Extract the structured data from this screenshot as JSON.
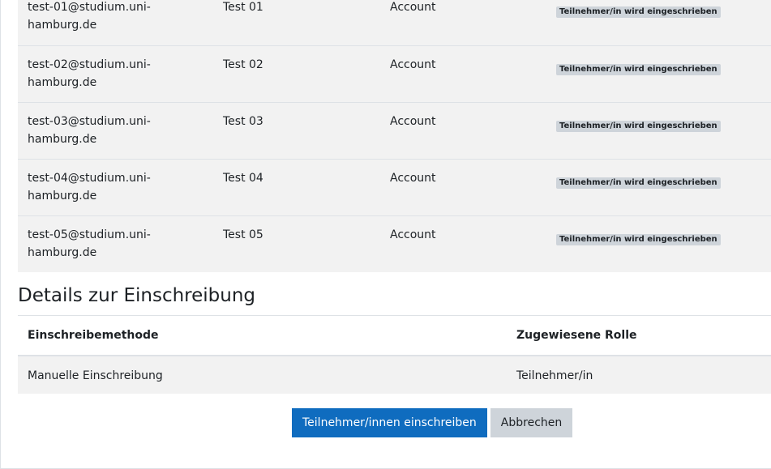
{
  "users": [
    {
      "email": "test-01@studium.uni-hamburg.de",
      "name": "Test 01",
      "type": "Account",
      "status": "Teilnehmer/in wird eingeschrieben"
    },
    {
      "email": "test-02@studium.uni-hamburg.de",
      "name": "Test 02",
      "type": "Account",
      "status": "Teilnehmer/in wird eingeschrieben"
    },
    {
      "email": "test-03@studium.uni-hamburg.de",
      "name": "Test 03",
      "type": "Account",
      "status": "Teilnehmer/in wird eingeschrieben"
    },
    {
      "email": "test-04@studium.uni-hamburg.de",
      "name": "Test 04",
      "type": "Account",
      "status": "Teilnehmer/in wird eingeschrieben"
    },
    {
      "email": "test-05@studium.uni-hamburg.de",
      "name": "Test 05",
      "type": "Account",
      "status": "Teilnehmer/in wird eingeschrieben"
    }
  ],
  "details": {
    "title": "Details zur Einschreibung",
    "headers": {
      "method": "Einschreibemethode",
      "role": "Zugewiesene Rolle"
    },
    "row": {
      "method": "Manuelle Einschreibung",
      "role": "Teilnehmer/in"
    }
  },
  "actions": {
    "enrol_label": "Teilnehmer/innen einschreiben",
    "cancel_label": "Abbrechen"
  },
  "colors": {
    "primary": "#0f6cbf",
    "secondary": "#ced4da",
    "row_bg": "#f2f2f2"
  }
}
